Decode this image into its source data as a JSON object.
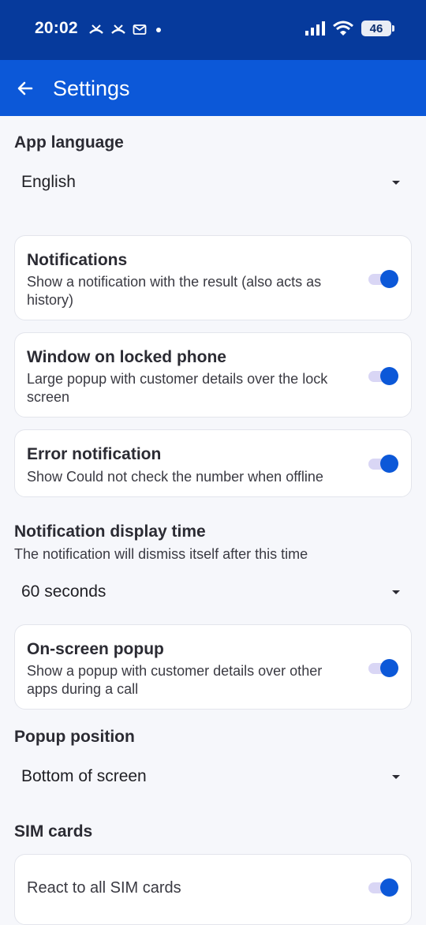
{
  "status_bar": {
    "time": "20:02",
    "battery": "46"
  },
  "app_bar": {
    "title": "Settings"
  },
  "app_language": {
    "title": "App language",
    "value": "English"
  },
  "cards": {
    "notifications": {
      "title": "Notifications",
      "desc": "Show a notification with the result (also acts as history)",
      "enabled": true
    },
    "locked_window": {
      "title": "Window on locked phone",
      "desc": "Large popup with customer details over the lock screen",
      "enabled": true
    },
    "error_notification": {
      "title": "Error notification",
      "desc": "Show Could not check the number when offline",
      "enabled": true
    },
    "onscreen_popup": {
      "title": "On-screen popup",
      "desc": "Show a popup with customer details over other apps during a call",
      "enabled": true
    },
    "all_sims": {
      "title": "React to all SIM cards",
      "enabled": true
    }
  },
  "display_time": {
    "title": "Notification display time",
    "subtitle": "The notification will dismiss itself after this time",
    "value": "60 seconds"
  },
  "popup_position": {
    "title": "Popup position",
    "value": "Bottom of screen"
  },
  "sim_cards": {
    "title": "SIM cards"
  },
  "colors": {
    "status_bar": "#063a9c",
    "app_bar": "#0c58d8",
    "toggle_on": "#0c58d8"
  }
}
